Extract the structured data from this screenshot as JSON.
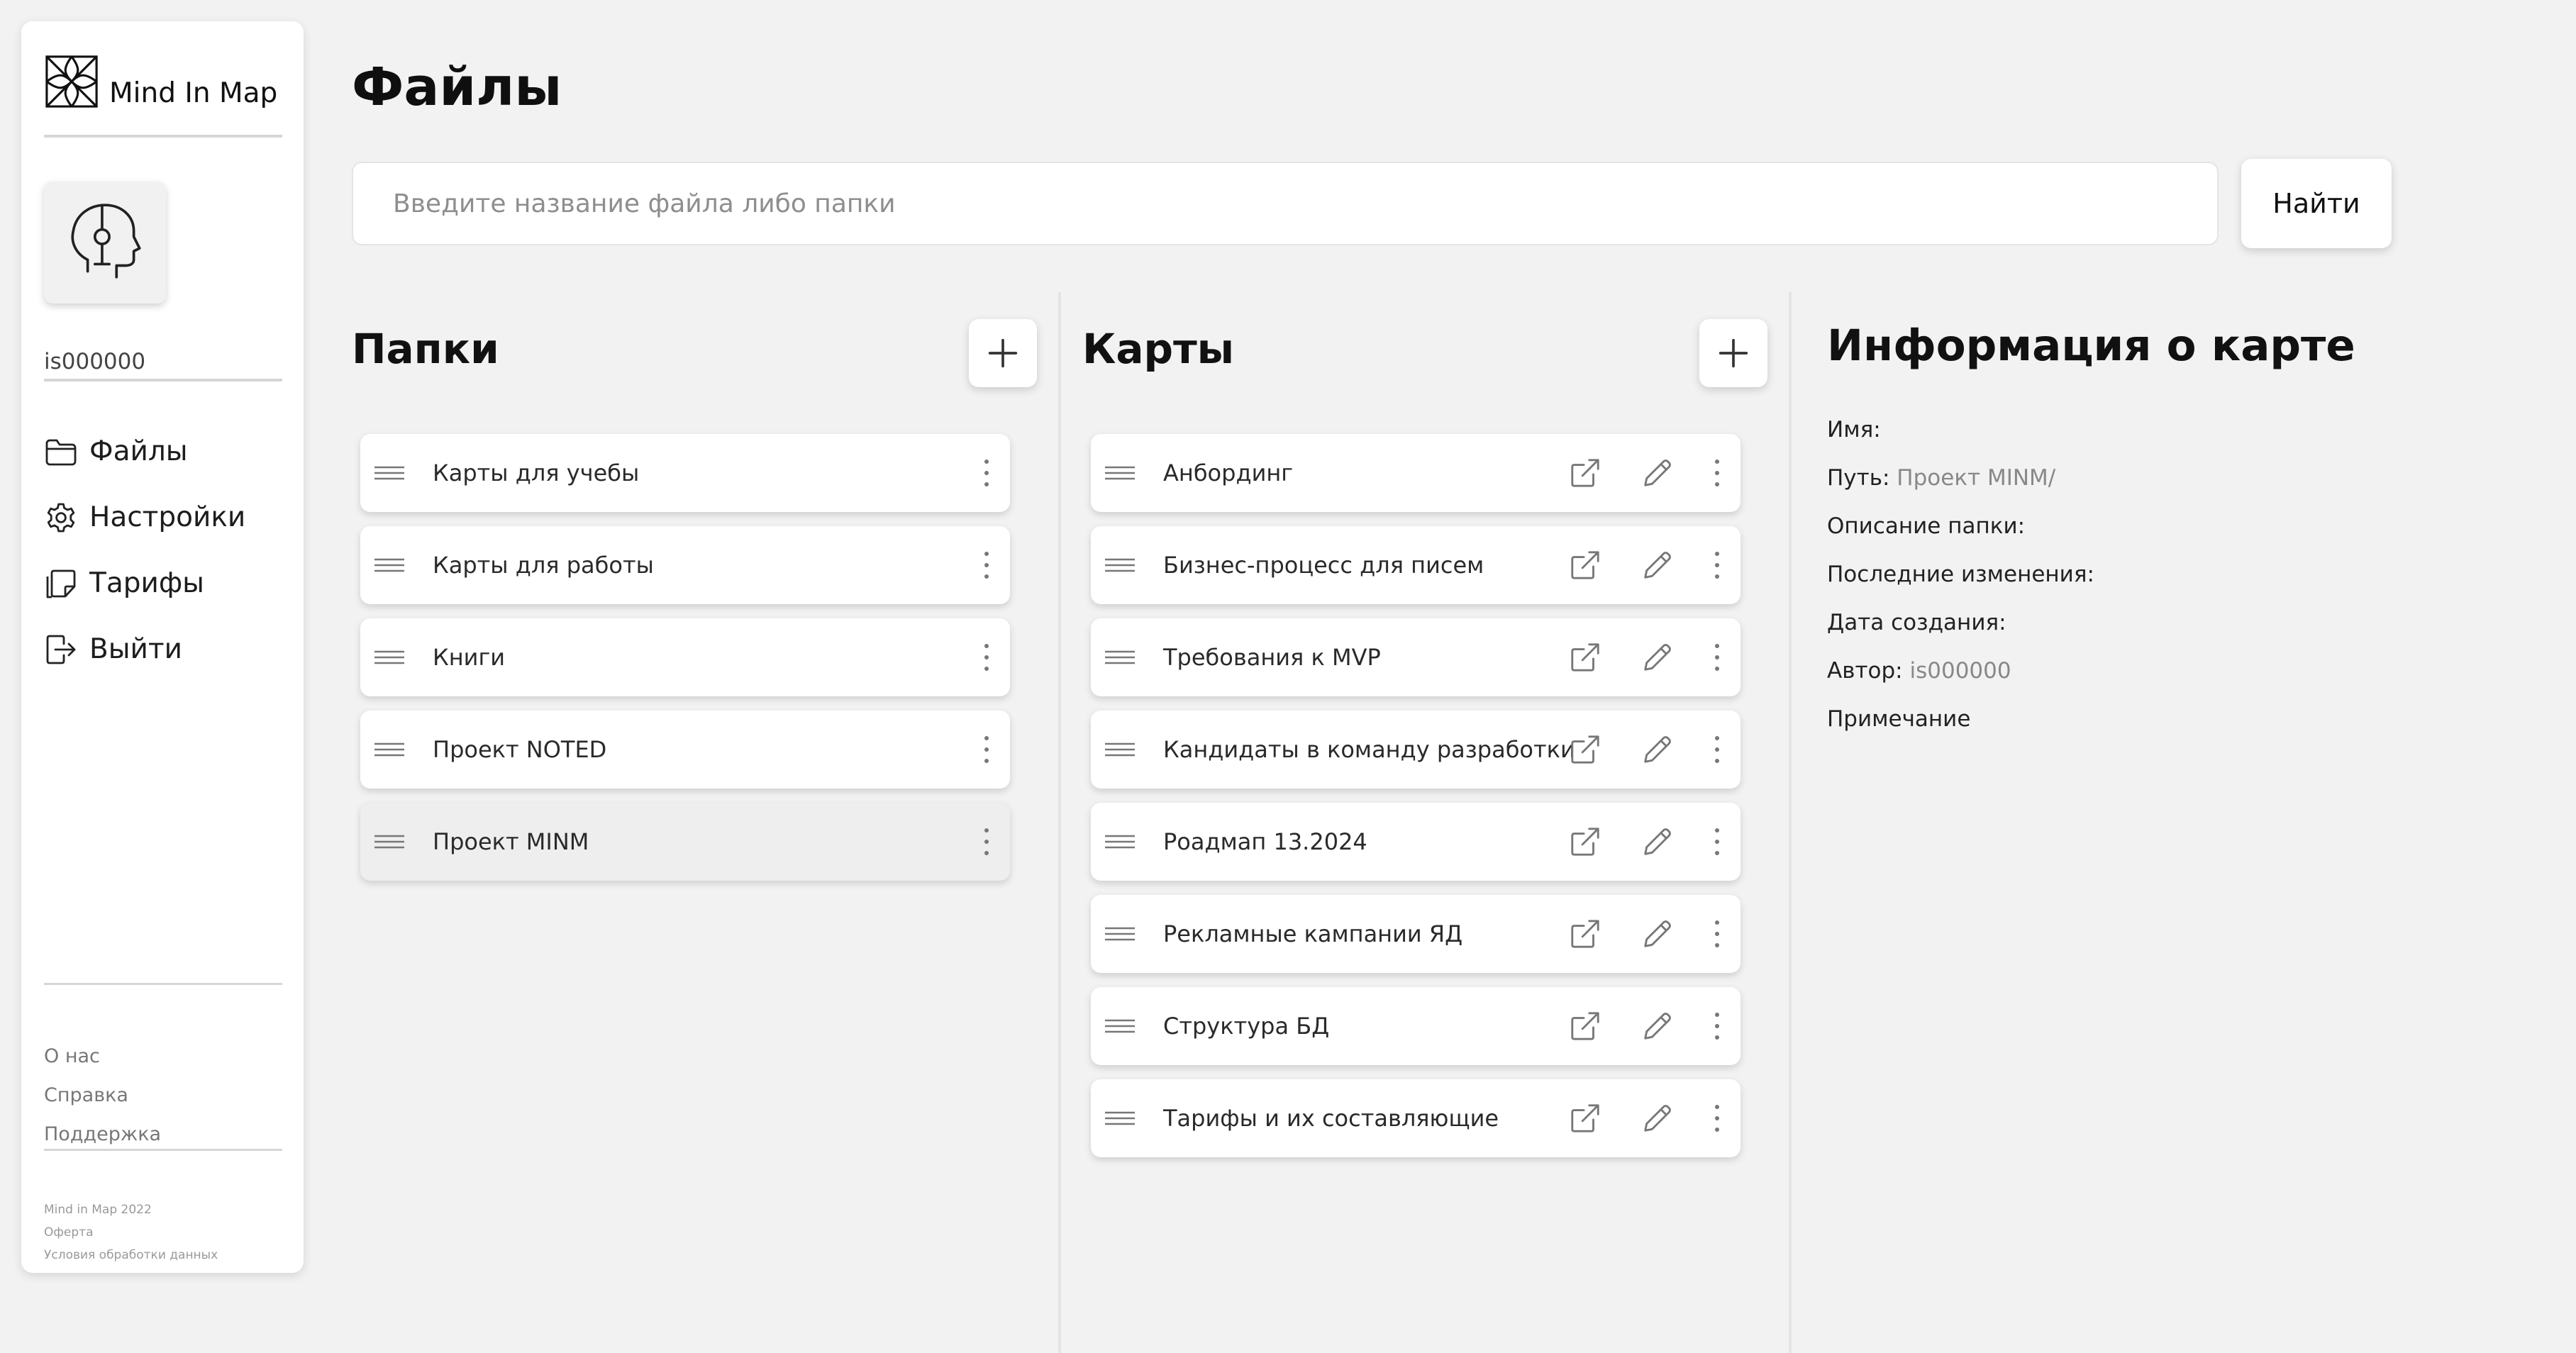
{
  "app": {
    "name": "Mind In Map"
  },
  "user": {
    "username": "is000000"
  },
  "nav": [
    {
      "label": "Файлы",
      "icon": "folder-icon"
    },
    {
      "label": "Настройки",
      "icon": "gear-icon"
    },
    {
      "label": "Тарифы",
      "icon": "tariff-icon"
    },
    {
      "label": "Выйти",
      "icon": "logout-icon"
    }
  ],
  "links": [
    "О нас",
    "Справка",
    "Поддержка"
  ],
  "footer": [
    "Mind in Map 2022",
    "Оферта",
    "Условия обработки данных"
  ],
  "page": {
    "title": "Файлы"
  },
  "search": {
    "placeholder": "Введите название файла либо папки",
    "button": "Найти"
  },
  "folders": {
    "title": "Папки",
    "items": [
      "Карты для учебы",
      "Карты для работы",
      "Книги",
      "Проект NOTED",
      "Проект MINM"
    ],
    "selected_index": 4
  },
  "maps": {
    "title": "Карты",
    "items": [
      "Анбординг",
      "Бизнес-процесс для писем",
      "Требования к MVP",
      "Кандидаты в команду разработки",
      "Роадмап 13.2024",
      "Рекламные кампании ЯД",
      "Структура БД",
      "Тарифы и их составляющие"
    ]
  },
  "info": {
    "title": "Информация о карте",
    "name_label": "Имя:",
    "path_label": "Путь:",
    "path_value": "Проект MINM/",
    "desc_label": "Описание папки:",
    "modified_label": "Последние изменения:",
    "created_label": "Дата создания:",
    "author_label": "Автор:",
    "author_value": "is000000",
    "note_label": "Примечание"
  },
  "colors": {
    "background": "#f2f2f2",
    "card": "#ffffff",
    "selected_row": "#eeeeee"
  }
}
